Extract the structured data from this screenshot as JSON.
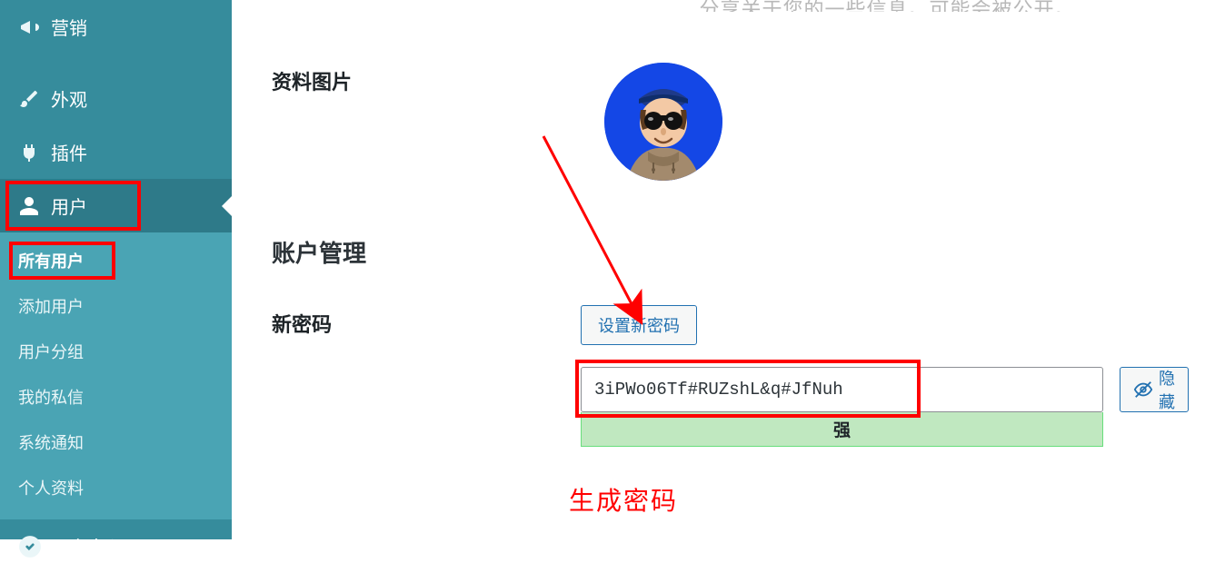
{
  "sidebar": {
    "items": [
      {
        "label": "营销",
        "icon": "megaphone-icon"
      },
      {
        "label": "外观",
        "icon": "brush-icon"
      },
      {
        "label": "插件",
        "icon": "plug-icon"
      },
      {
        "label": "用户",
        "icon": "user-icon"
      },
      {
        "label": "用户中心",
        "icon": "badge-icon"
      }
    ],
    "sub": [
      {
        "label": "所有用户"
      },
      {
        "label": "添加用户"
      },
      {
        "label": "用户分组"
      },
      {
        "label": "我的私信"
      },
      {
        "label": "系统通知"
      },
      {
        "label": "个人资料"
      }
    ]
  },
  "partial_top_text": "分享关于您的一些信息。可能会被公开。",
  "labels": {
    "profile_image": "资料图片",
    "account_manage": "账户管理",
    "new_password": "新密码"
  },
  "buttons": {
    "set_new_password": "设置新密码",
    "hide": "隐藏"
  },
  "password": {
    "value": "3iPWo06Tf#RUZshL&q#JfNuh",
    "strength": "强"
  },
  "annotation": {
    "generate_password": "生成密码"
  }
}
